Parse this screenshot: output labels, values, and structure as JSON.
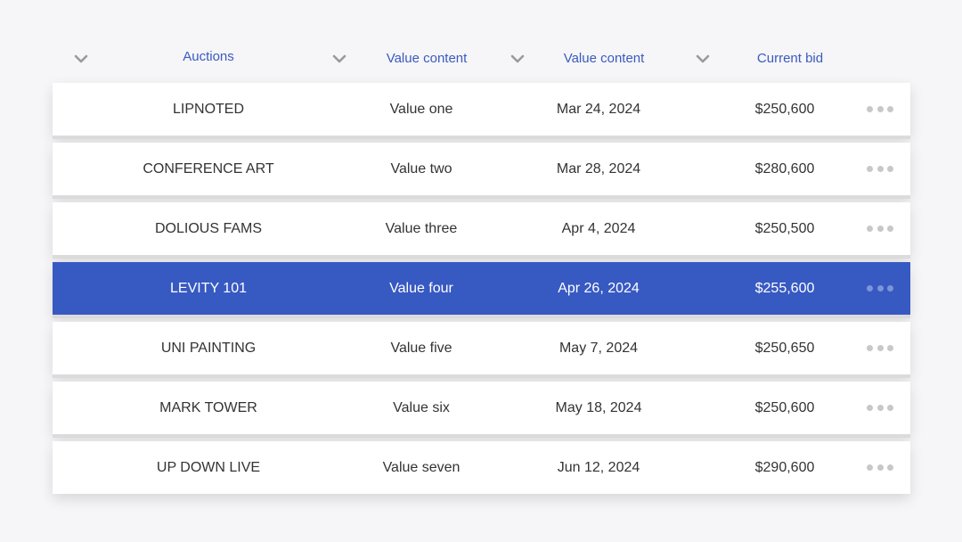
{
  "colors": {
    "header_text": "#3a5bbf",
    "selected_row": "#3759c2",
    "row_bg": "#ffffff",
    "page_bg": "#f6f5f7"
  },
  "header": {
    "col1": "Auctions",
    "col2": "Value content",
    "col3": "Value content",
    "col4": "Current bid"
  },
  "icons": {
    "sort": "chevron-down-icon",
    "more": "more-horizontal-icon"
  },
  "selected_index": 3,
  "rows": [
    {
      "name": "LIPNOTED",
      "value": "Value one",
      "date": "Mar 24, 2024",
      "bid": "$250,600"
    },
    {
      "name": "CONFERENCE ART",
      "value": "Value two",
      "date": "Mar 28, 2024",
      "bid": "$280,600"
    },
    {
      "name": "DOLIOUS FAMS",
      "value": "Value three",
      "date": "Apr 4, 2024",
      "bid": "$250,500"
    },
    {
      "name": "LEVITY 101",
      "value": "Value four",
      "date": "Apr 26, 2024",
      "bid": "$255,600"
    },
    {
      "name": "UNI PAINTING",
      "value": "Value five",
      "date": "May 7, 2024",
      "bid": "$250,650"
    },
    {
      "name": "MARK TOWER",
      "value": "Value six",
      "date": "May 18, 2024",
      "bid": "$250,600"
    },
    {
      "name": "UP DOWN LIVE",
      "value": "Value seven",
      "date": "Jun 12, 2024",
      "bid": "$290,600"
    }
  ]
}
